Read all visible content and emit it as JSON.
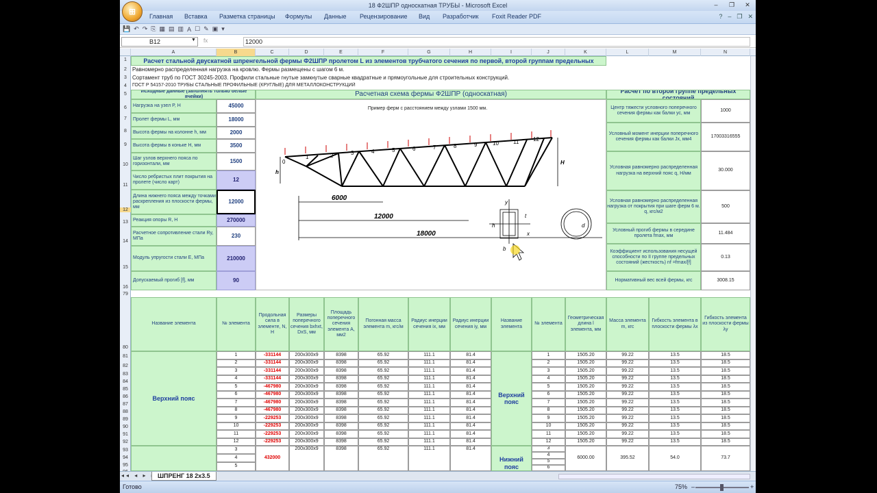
{
  "window": {
    "title": "18 Ф2ШПР односкатная ТРУБЫ - Microsoft Excel",
    "office_button": "⊞",
    "controls": [
      "–",
      "❐",
      "✕"
    ]
  },
  "ribbon": {
    "tabs": [
      "Главная",
      "Вставка",
      "Разметка страницы",
      "Формулы",
      "Данные",
      "Рецензирование",
      "Вид",
      "Разработчик",
      "Foxit Reader PDF"
    ],
    "help_icons": [
      "?",
      "–",
      "❐",
      "✕"
    ]
  },
  "qat": [
    "💾",
    "↶",
    "↷",
    "⎘",
    "▦",
    "▤",
    "▥",
    "A",
    "☐",
    "✎",
    "▣",
    "▾"
  ],
  "formula_bar": {
    "name_box": "B12",
    "fx": "fx",
    "value": "12000"
  },
  "columns": [
    "A",
    "B",
    "C",
    "D",
    "E",
    "F",
    "G",
    "H",
    "I",
    "J",
    "K",
    "L",
    "M",
    "N"
  ],
  "row_numbers": [
    "1",
    "2",
    "3",
    "4",
    "5",
    "6",
    "7",
    "8",
    "9",
    "10",
    "11",
    "12",
    "13",
    "14",
    "15",
    "16",
    "79",
    "80",
    "81",
    "82",
    "83",
    "84",
    "85",
    "86",
    "87",
    "88",
    "89",
    "90",
    "91",
    "92",
    "93",
    "94",
    "95",
    "96"
  ],
  "title_row": "Расчет стальной двускатной шпренгельной фермы Ф2ШПР пролетом L из элементов трубчатого сечения по первой, второй группам предельных",
  "row2": "Равномерно распределенная нагрузка на кровлю. Фермы размещены с шагом 6 м.",
  "row3": "Сортамент труб по ГОСТ 30245-2003. Профили стальные гнутые замкнутые сварные квадратные и прямоугольные для строительных конструкций.",
  "row4": "ГОСТ Р 54157-2010 ТРУБЫ СТАЛЬНЫЕ ПРОФИЛЬНЫЕ (КРУГЛЫЕ) ДЛЯ МЕТАЛЛОКОНСТРУКЦИЙ",
  "input_header": "Исходные данные (заполнять только белые ячейки)",
  "scheme_header": "Расчетная схема фермы Ф2ШПР (односкатная)",
  "second_group_header": "Расчет по второй группе предельных состояний",
  "inputs": [
    {
      "label": "Нагрузка на узел P, Н",
      "value": "45000",
      "kind": "white"
    },
    {
      "label": "Пролет фермы L, мм",
      "value": "18000",
      "kind": "white"
    },
    {
      "label": "Высота фермы на колонне h, мм",
      "value": "2000",
      "kind": "white"
    },
    {
      "label": "Высота фермы в коньке H, мм",
      "value": "3500",
      "kind": "white"
    },
    {
      "label": "Шаг узлов верхнего пояса по горизонтали, мм",
      "value": "1500",
      "kind": "white"
    },
    {
      "label": "Число ребристых плит покрытия на пролете (число карт)",
      "value": "12",
      "kind": "lav"
    },
    {
      "label": "Длина нижнего пояса между точками раскрепления из плоскости фермы, мм",
      "value": "12000",
      "kind": "white"
    },
    {
      "label": "Реакция опоры R, Н",
      "value": "270000",
      "kind": "lav"
    },
    {
      "label": "Расчетное сопротивление стали Ry, МПа",
      "value": "230",
      "kind": "white"
    },
    {
      "label": "Модуль упругости стали Е, МПа",
      "value": "210000",
      "kind": "lav"
    },
    {
      "label": "Допускаемый прогиб [f], мм",
      "value": "90",
      "kind": "lav"
    }
  ],
  "diagram": {
    "caption": "Пример ферм с расстоянием между узлами 1500 мм.",
    "dims": [
      "6000",
      "12000",
      "18000"
    ],
    "node_labels": [
      "0",
      "1",
      "2",
      "3",
      "4",
      "5",
      "6",
      "7",
      "8",
      "9",
      "10",
      "11",
      "12"
    ],
    "h": "h",
    "H": "H",
    "t": "t",
    "x": "x",
    "y": "y",
    "b": "b",
    "d": "d"
  },
  "second_group": [
    {
      "label": "Центр тяжести условного поперечного сечения фермы как балки ус, мм",
      "value": "1000"
    },
    {
      "label": "Условный момент инерции поперечного сечения фермы как балки Jx, мм4",
      "value": "17003316555"
    },
    {
      "label": "Условная равномерно распределенная нагрузка на верхний пояс q, Н/мм",
      "value": "30.000"
    },
    {
      "label": "Условная равномерно распределенная нагрузка от покрытия при шаге ферм 6 м. q, кгс/м2",
      "value": "500"
    },
    {
      "label": "Условный прогиб фермы в середине пролета fmax, мм",
      "value": "11.484"
    },
    {
      "label": "Коэффициент использования несущей способности по II группе предельных состояний (жесткость) nf =fmax/[f]",
      "value": "0.13"
    },
    {
      "label": "Нормативный вес всей фермы, кгс",
      "value": "3008.15"
    }
  ],
  "table_headers": [
    "Название элемента",
    "№ элемента",
    "Продольная сила в элементе, N, Н",
    "Размеры поперечного сечения bxhxt, DxS, мм",
    "Площадь поперечного сечения элемента А, мм2",
    "Погонная масса элемента m, кгс/м",
    "Радиус инерции сечения ix, мм",
    "Радиус инерции сечения iy, мм",
    "Название элемента",
    "№ элемента",
    "Геометрическая длина l элемента, мм",
    "Масса элемента m, кгс",
    "Гибкость элемента в плоскости фермы λx",
    "Гибкость элемента из плоскости фермы λy"
  ],
  "group1_name": "Верхний пояс",
  "group2_name": "Нижний пояс",
  "rows": [
    {
      "n": "1",
      "N": "-331144",
      "sec": "200x300x9",
      "A": "8398",
      "m": "65.92",
      "ix": "111.1",
      "iy": "81.4",
      "n2": "1",
      "l": "1505.20",
      "mass": "99.22",
      "lx": "13.5",
      "ly": "18.5"
    },
    {
      "n": "2",
      "N": "-331144",
      "sec": "200x300x9",
      "A": "8398",
      "m": "65.92",
      "ix": "111.1",
      "iy": "81.4",
      "n2": "2",
      "l": "1505.20",
      "mass": "99.22",
      "lx": "13.5",
      "ly": "18.5"
    },
    {
      "n": "3",
      "N": "-331144",
      "sec": "200x300x9",
      "A": "8398",
      "m": "65.92",
      "ix": "111.1",
      "iy": "81.4",
      "n2": "3",
      "l": "1505.20",
      "mass": "99.22",
      "lx": "13.5",
      "ly": "18.5"
    },
    {
      "n": "4",
      "N": "-331144",
      "sec": "200x300x9",
      "A": "8398",
      "m": "65.92",
      "ix": "111.1",
      "iy": "81.4",
      "n2": "4",
      "l": "1505.20",
      "mass": "99.22",
      "lx": "13.5",
      "ly": "18.5"
    },
    {
      "n": "5",
      "N": "-467980",
      "sec": "200x300x9",
      "A": "8398",
      "m": "65.92",
      "ix": "111.1",
      "iy": "81.4",
      "n2": "5",
      "l": "1505.20",
      "mass": "99.22",
      "lx": "13.5",
      "ly": "18.5"
    },
    {
      "n": "6",
      "N": "-467980",
      "sec": "200x300x9",
      "A": "8398",
      "m": "65.92",
      "ix": "111.1",
      "iy": "81.4",
      "n2": "6",
      "l": "1505.20",
      "mass": "99.22",
      "lx": "13.5",
      "ly": "18.5"
    },
    {
      "n": "7",
      "N": "-467980",
      "sec": "200x300x9",
      "A": "8398",
      "m": "65.92",
      "ix": "111.1",
      "iy": "81.4",
      "n2": "7",
      "l": "1505.20",
      "mass": "99.22",
      "lx": "13.5",
      "ly": "18.5"
    },
    {
      "n": "8",
      "N": "-467980",
      "sec": "200x300x9",
      "A": "8398",
      "m": "65.92",
      "ix": "111.1",
      "iy": "81.4",
      "n2": "8",
      "l": "1505.20",
      "mass": "99.22",
      "lx": "13.5",
      "ly": "18.5"
    },
    {
      "n": "9",
      "N": "-229253",
      "sec": "200x300x9",
      "A": "8398",
      "m": "65.92",
      "ix": "111.1",
      "iy": "81.4",
      "n2": "9",
      "l": "1505.20",
      "mass": "99.22",
      "lx": "13.5",
      "ly": "18.5"
    },
    {
      "n": "10",
      "N": "-229253",
      "sec": "200x300x9",
      "A": "8398",
      "m": "65.92",
      "ix": "111.1",
      "iy": "81.4",
      "n2": "10",
      "l": "1505.20",
      "mass": "99.22",
      "lx": "13.5",
      "ly": "18.5"
    },
    {
      "n": "11",
      "N": "-229253",
      "sec": "200x300x9",
      "A": "8398",
      "m": "65.92",
      "ix": "111.1",
      "iy": "81.4",
      "n2": "11",
      "l": "1505.20",
      "mass": "99.22",
      "lx": "13.5",
      "ly": "18.5"
    },
    {
      "n": "12",
      "N": "-229253",
      "sec": "200x300x9",
      "A": "8398",
      "m": "65.92",
      "ix": "111.1",
      "iy": "81.4",
      "n2": "12",
      "l": "1505.20",
      "mass": "99.22",
      "lx": "13.5",
      "ly": "18.5"
    }
  ],
  "bottom": {
    "nums": [
      "3",
      "4",
      "5"
    ],
    "N": "432000",
    "sec": "200x300x9",
    "A": "8398",
    "m": "65.92",
    "ix": "111.1",
    "iy": "81.4",
    "nums2": [
      "3",
      "4",
      "5",
      "6"
    ],
    "l": "6000.00",
    "mass": "395.52",
    "lx": "54.0",
    "ly": "73.7"
  },
  "sheet_tab": "ШПРЕНГ 18 2x3.5",
  "sheet_nav": "◂◂ ◂ ▸ ▸▸",
  "status": {
    "ready": "Готово",
    "zoom": "75%",
    "zoom_minus": "–",
    "zoom_plus": "+"
  },
  "colors": {
    "green": "#ccf5cc",
    "lavender": "#ccccf5",
    "red": "#e00000"
  }
}
